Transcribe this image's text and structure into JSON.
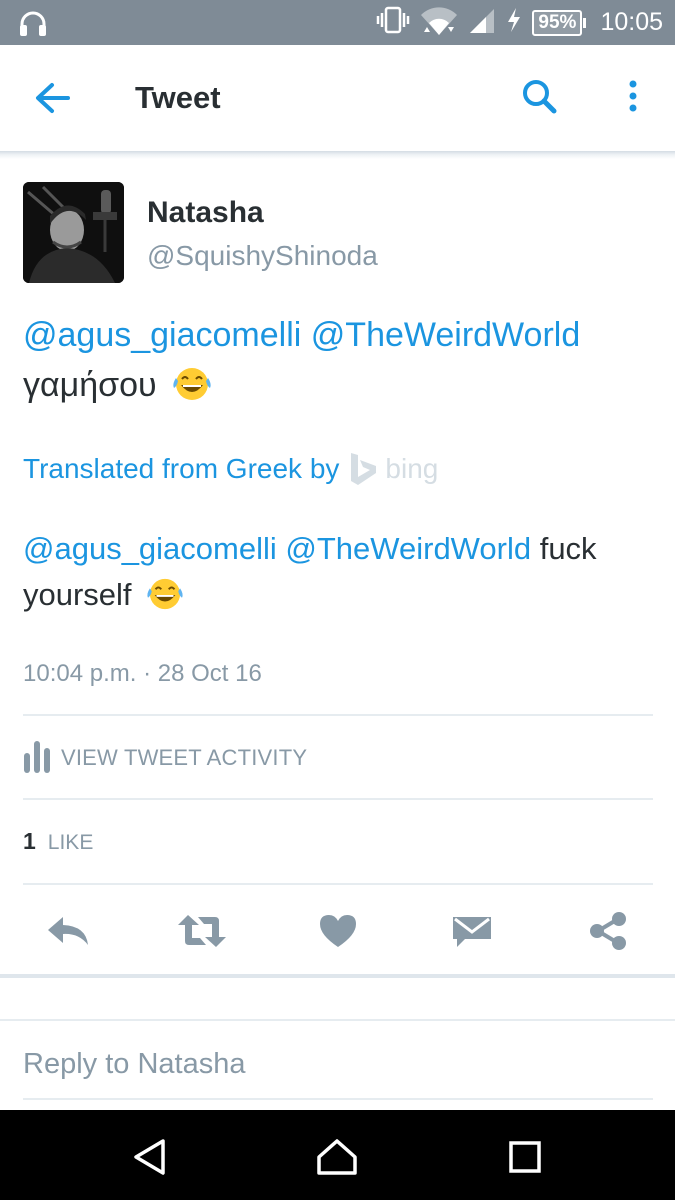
{
  "status_bar": {
    "battery": "95%",
    "time": "10:05",
    "icons": [
      "headphones-icon",
      "vibrate-icon",
      "wifi-icon",
      "cellular-signal-icon",
      "charging-icon",
      "battery-icon"
    ]
  },
  "app_bar": {
    "title": "Tweet",
    "back_icon": "arrow-left-icon",
    "search_icon": "search-icon",
    "more_icon": "more-vertical-icon"
  },
  "tweet": {
    "author": {
      "name": "Natasha",
      "handle": "@SquishyShinoda"
    },
    "text": {
      "mention_1": "@agus_giacomelli",
      "mention_2": "@TheWeirdWorld",
      "body": "γαμήσου",
      "emoji": "face-with-tears-of-joy"
    },
    "translation_note": {
      "label": "Translated from Greek by",
      "provider": "bing"
    },
    "translation": {
      "mention_1": "@agus_giacomelli",
      "mention_2": "@TheWeirdWorld",
      "body": "fuck yourself",
      "emoji": "face-with-tears-of-joy"
    },
    "timestamp": "10:04 p.m. · 28 Oct 16",
    "activity_label": "VIEW TWEET ACTIVITY",
    "likes": {
      "count": "1",
      "label": "LIKE"
    },
    "actions": [
      "reply-icon",
      "retweet-icon",
      "like-heart-icon",
      "direct-message-icon",
      "share-icon"
    ]
  },
  "colors": {
    "accent": "#1b95e0",
    "text": "#292f33",
    "muted": "#8899a6",
    "icon": "#8899a6",
    "status_bar": "#7f8b96"
  },
  "reply": {
    "placeholder": "Reply to Natasha"
  },
  "nav_bar": {
    "icons": [
      "back-triangle-icon",
      "home-icon",
      "recents-icon"
    ]
  }
}
